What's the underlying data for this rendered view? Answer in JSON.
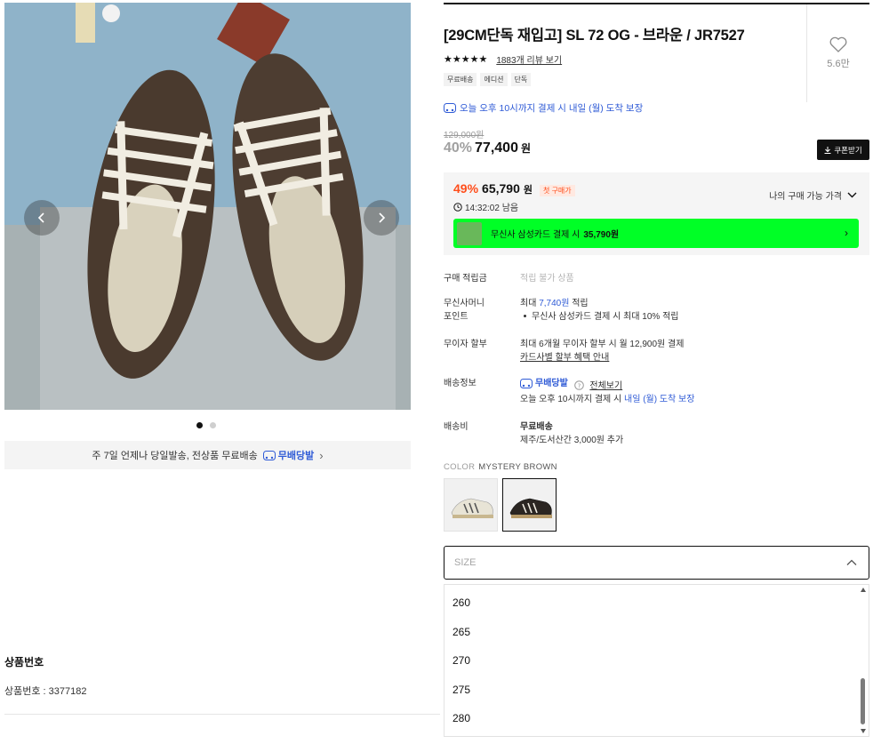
{
  "product": {
    "title": "[29CM단독 재입고] SL 72 OG - 브라운 / JR7527",
    "stars": "★★★★★",
    "review_link": "1883개 리뷰 보기",
    "tags": [
      "무료배송",
      "에디션",
      "단독"
    ],
    "like_count": "5.6만",
    "delivery_note": "오늘 오후 10시까지 결제 시 내일 (월) 도착 보장"
  },
  "gallery": {
    "banner_text": "주 7일 언제나 당일발송, 전상품 무료배송",
    "banner_brand": "무배당발",
    "banner_chevron": "›"
  },
  "pricing": {
    "original_price": "129,000원",
    "discount": "40%",
    "price": "77,400",
    "price_unit": "원",
    "coupon_label": "쿠폰받기",
    "best_discount": "49%",
    "best_price": "65,790",
    "best_unit": "원",
    "first_purchase_badge": "첫 구매가",
    "my_price_label": "나의 구매 가능 가격",
    "timer": "14:32:02 남음",
    "card_text": "무신사 삼성카드 결제 시",
    "card_price": "35,790원"
  },
  "info": {
    "points_label": "구매 적립금",
    "points_value": "적립 불가 상품",
    "money_label_1": "무신사머니",
    "money_label_2": "포인트",
    "money_prefix": "최대 ",
    "money_amount": "7,740원",
    "money_suffix": " 적립",
    "money_bullet": "무신사 삼성카드 결제 시 최대 10% 적립",
    "installment_label": "무이자 할부",
    "installment_text": "최대 6개월 무이자 할부 시 월 12,900원 결제",
    "installment_link": "카드사별 할부 혜택 안내",
    "shipping_label": "배송정보",
    "shipping_brand": "무배당발",
    "shipping_all": "전체보기",
    "shipping_note_prefix": "오늘 오후 10시까지 결제 시 ",
    "shipping_note_blue": "내일 (월) 도착 보장",
    "fee_label": "배송비",
    "fee_value": "무료배송",
    "fee_note": "제주/도서산간 3,000원 추가"
  },
  "color": {
    "label": "COLOR",
    "value": "MYSTERY BROWN"
  },
  "size": {
    "placeholder": "SIZE",
    "options": [
      "260",
      "265",
      "270",
      "275",
      "280"
    ]
  },
  "product_no": {
    "title": "상품번호",
    "value": "상품번호 : 3377182"
  },
  "colors": {
    "accent_blue": "#2f5bd6",
    "sale_orange": "#ff4d1a",
    "card_green": "#00ff26"
  }
}
